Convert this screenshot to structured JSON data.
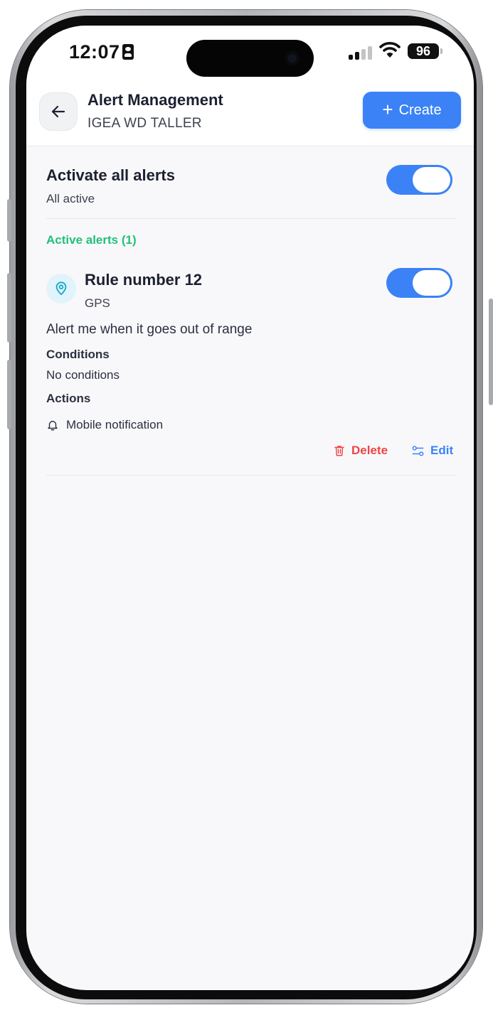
{
  "status_bar": {
    "time": "12:07",
    "battery": "96"
  },
  "header": {
    "title": "Alert Management",
    "subtitle": "IGEA WD TALLER",
    "create_label": "Create"
  },
  "activate_all": {
    "title": "Activate all alerts",
    "subtitle": "All active",
    "enabled": true
  },
  "active_alerts_label": "Active alerts (1)",
  "alerts": [
    {
      "title": "Rule number 12",
      "type": "GPS",
      "description": "Alert me when it goes out of range",
      "conditions_label": "Conditions",
      "conditions_value": "No conditions",
      "actions_label": "Actions",
      "actions": [
        "Mobile notification"
      ],
      "enabled": true,
      "delete_label": "Delete",
      "edit_label": "Edit"
    }
  ],
  "colors": {
    "accent": "#3b82f6",
    "success": "#22c07a",
    "danger": "#ef4444",
    "background": "#f8f8fa"
  },
  "icons": {
    "back": "arrow-left-icon",
    "create": "plus-icon",
    "alert_type": "map-pin-icon",
    "action": "bell-icon",
    "delete": "trash-icon",
    "edit": "sliders-icon"
  }
}
